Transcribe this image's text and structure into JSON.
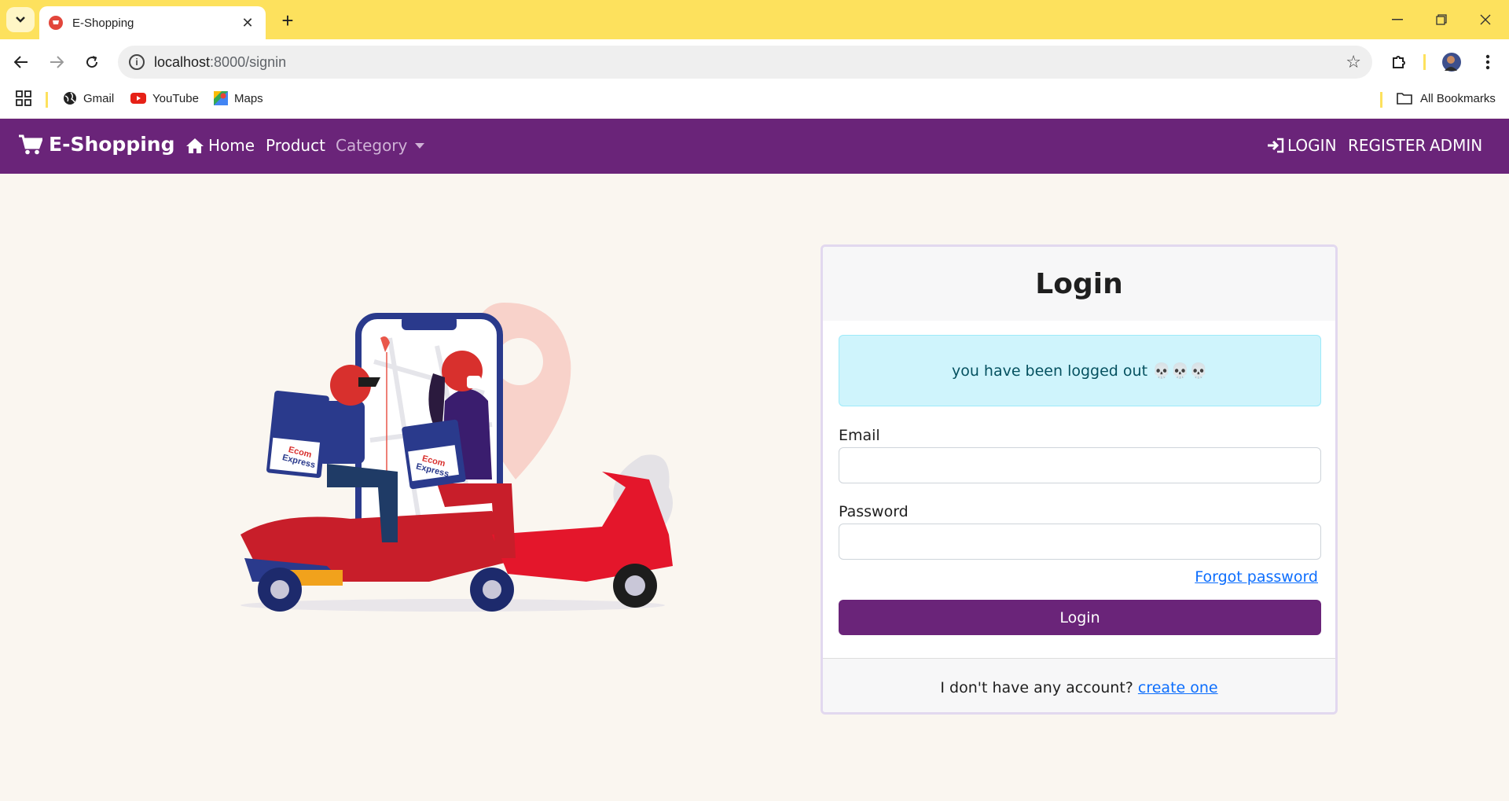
{
  "browser": {
    "tab_title": "E-Shopping",
    "url_host": "localhost",
    "url_path": ":8000/signin",
    "bookmarks": [
      {
        "label": "Gmail",
        "icon": "globe-icon"
      },
      {
        "label": "YouTube",
        "icon": "youtube-icon"
      },
      {
        "label": "Maps",
        "icon": "maps-icon"
      }
    ],
    "all_bookmarks_label": "All Bookmarks"
  },
  "navbar": {
    "brand": "E-Shopping",
    "home": "Home",
    "product": "Product",
    "category": "Category",
    "login": "LOGIN",
    "register": "REGISTER",
    "admin": "ADMIN",
    "bg_color": "#6a2479"
  },
  "illustration": {
    "box_text_1": "Ecom",
    "box_text_2": "Express"
  },
  "login_card": {
    "title": "Login",
    "alert_message": "you have been logged out 💀💀💀",
    "email_label": "Email",
    "email_value": "",
    "password_label": "Password",
    "password_value": "",
    "forgot_password": "Forgot password",
    "submit_label": "Login",
    "footer_text": "I don't have any account?",
    "footer_link": "create one"
  }
}
